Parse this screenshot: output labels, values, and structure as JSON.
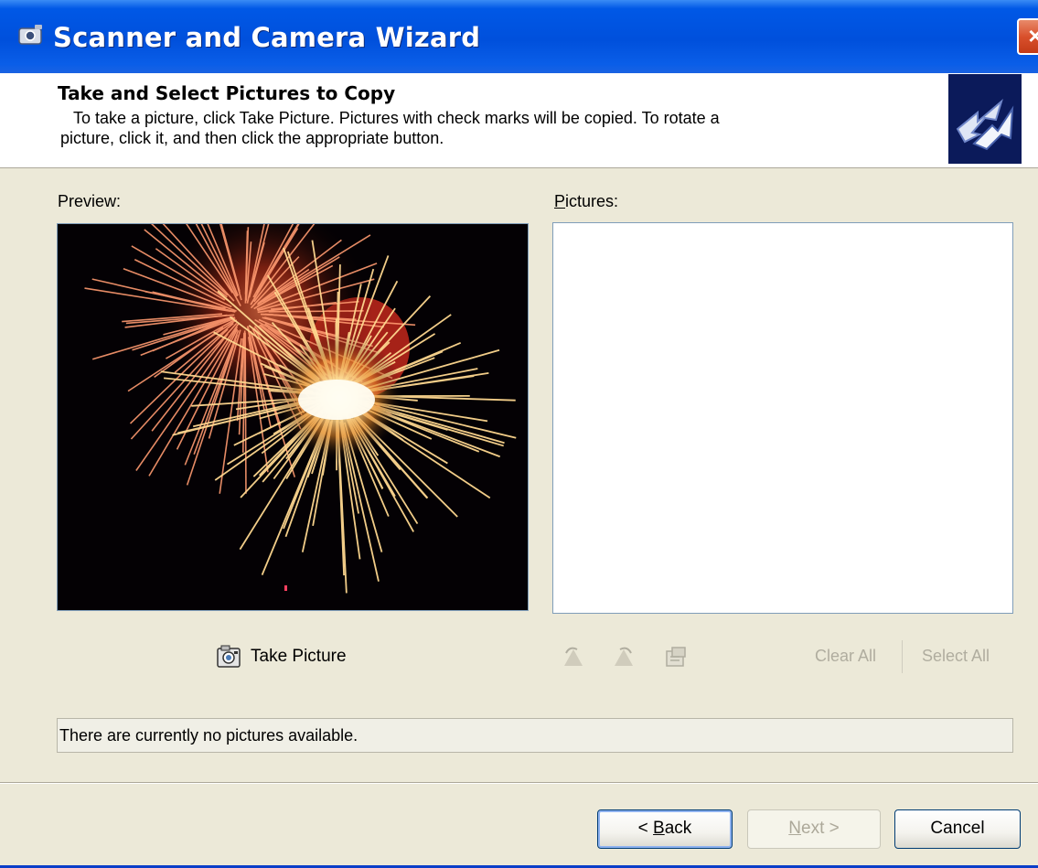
{
  "window": {
    "title": "Scanner and Camera Wizard",
    "close_label": "×"
  },
  "header": {
    "title": "Take and Select Pictures to Copy",
    "description_line1": "To take a picture, click Take Picture. Pictures with check marks will be copied. To rotate a",
    "description_line2": "picture, click it, and then click the appropriate button."
  },
  "preview": {
    "label": "Preview:"
  },
  "pictures": {
    "label_accel": "P",
    "label_rest": "ictures:"
  },
  "toolbar": {
    "take_picture_label": "Take Picture",
    "clear_all_label": "Clear All",
    "select_all_label": "Select All"
  },
  "status": {
    "text": "There are currently no pictures available."
  },
  "buttons": {
    "back_prefix": "< ",
    "back_accel": "B",
    "back_rest": "ack",
    "next_accel": "N",
    "next_rest": "ext >",
    "cancel_label": "Cancel"
  },
  "colors": {
    "titlebar": "#0050dc",
    "dialog_bg": "#ece9d8",
    "disabled_text": "#aca899"
  },
  "icons": {
    "title": "scanner-camera-icon",
    "header": "wizard-arrows-icon",
    "take_picture": "camera-icon",
    "rotate_left": "rotate-left-icon",
    "rotate_right": "rotate-right-icon",
    "properties": "properties-icon"
  }
}
